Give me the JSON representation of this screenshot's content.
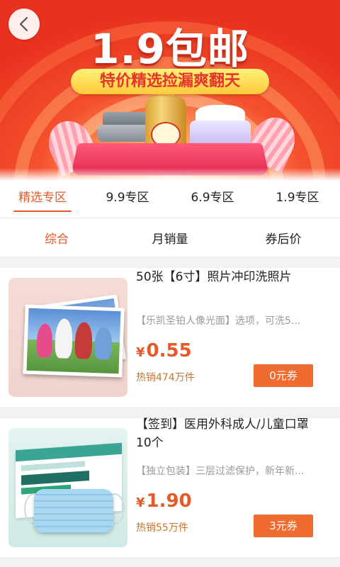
{
  "banner": {
    "title": "1.9包邮",
    "subtitle": "特价精选捡漏爽翻天",
    "back_icon": "chevron-left-icon"
  },
  "zone_tabs": [
    {
      "label": "精选专区",
      "active": true
    },
    {
      "label": "9.9专区",
      "active": false
    },
    {
      "label": "6.9专区",
      "active": false
    },
    {
      "label": "1.9专区",
      "active": false
    }
  ],
  "sort_options": [
    {
      "label": "综合",
      "active": true
    },
    {
      "label": "月销量",
      "active": false
    },
    {
      "label": "券后价",
      "active": false
    }
  ],
  "products": [
    {
      "title": "50张【6寸】照片冲印洗照片",
      "description": "【乐凯圣铂人像光面】选项，可洗5...",
      "currency": "¥",
      "price": "0.55",
      "sales": "热销474万件",
      "coupon": "0元券"
    },
    {
      "title": "【签到】医用外科成人/儿童口罩10个",
      "description": "【独立包装】三层过滤保护，新年新...",
      "currency": "¥",
      "price": "1.90",
      "sales": "热销55万件",
      "coupon": "3元券"
    }
  ],
  "colors": {
    "accent": "#e35b2a",
    "coupon_bg": "#f06b30",
    "sales_text": "#c9742c"
  }
}
